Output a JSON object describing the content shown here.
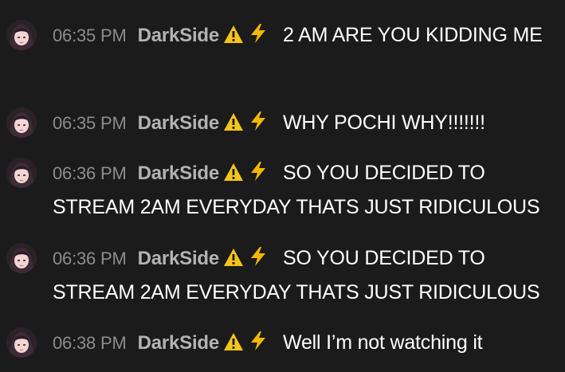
{
  "messages": [
    {
      "time": "06:35 PM",
      "user": "DarkSide",
      "badges": [
        "warning-icon",
        "lightning-icon"
      ],
      "text": "2 AM ARE YOU KIDDING ME"
    },
    {
      "time": "06:35 PM",
      "user": "DarkSide",
      "badges": [
        "warning-icon",
        "lightning-icon"
      ],
      "text": "WHY POCHI WHY!!!!!!!"
    },
    {
      "time": "06:36 PM",
      "user": "DarkSide",
      "badges": [
        "warning-icon",
        "lightning-icon"
      ],
      "text": "SO YOU DECIDED TO STREAM 2AM EVERYDAY THATS JUST RIDICULOUS"
    },
    {
      "time": "06:36 PM",
      "user": "DarkSide",
      "badges": [
        "warning-icon",
        "lightning-icon"
      ],
      "text": "SO YOU DECIDED TO STREAM 2AM EVERYDAY THATS JUST RIDICULOUS"
    },
    {
      "time": "06:38 PM",
      "user": "DarkSide",
      "badges": [
        "warning-icon",
        "lightning-icon"
      ],
      "text": "Well I’m not watching it"
    }
  ],
  "colors": {
    "background": "#1b1b1c",
    "timestamp": "#8c8c8c",
    "username": "#b3b3b3",
    "message": "#ffffff",
    "warning_badge": "#f5c518",
    "lightning_badge": "#f5b800"
  }
}
